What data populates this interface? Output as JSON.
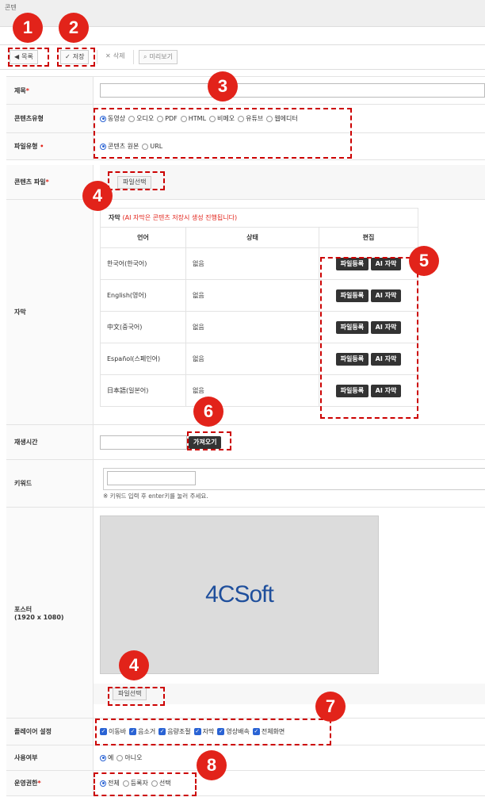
{
  "window": {
    "title": "콘텐"
  },
  "toolbar": {
    "list_label": "목록",
    "save_label": "저장",
    "delete_label": "삭제",
    "preview_label": "미리보기"
  },
  "form": {
    "title_label": "제목",
    "content_type_label": "콘텐츠유형",
    "content_types": [
      "동영상",
      "오디오",
      "PDF",
      "HTML",
      "비메오",
      "유튜브",
      "웹에디터"
    ],
    "file_type_label": "파일유형",
    "file_types": [
      "콘텐츠 원본",
      "URL"
    ],
    "content_file_label": "콘텐츠 파일",
    "file_select": "파일선택",
    "subtitle_label": "자막",
    "subtitle_title": "자막",
    "subtitle_note": "(AI 자막은 콘텐츠 저장시 생성 진행됩니다)",
    "subtitle_headers": [
      "언어",
      "상태",
      "편집"
    ],
    "subtitle_rows": [
      {
        "lang": "한국어(한국어)",
        "status": "없음"
      },
      {
        "lang": "English(영어)",
        "status": "없음"
      },
      {
        "lang": "中文(중국어)",
        "status": "없음"
      },
      {
        "lang": "Español(스페인어)",
        "status": "없음"
      },
      {
        "lang": "日本語(일본어)",
        "status": "없음"
      }
    ],
    "upload_btn": "파일등록",
    "ai_btn": "AI 자막",
    "playtime_label": "재생시간",
    "fetch_btn": "가져오기",
    "keyword_label": "키워드",
    "keyword_hint": "※ 키워드 입력 후 enter키를 눌러 주세요.",
    "poster_label": "포스터",
    "poster_size": "(1920 x 1080)",
    "poster_logo": "4CSoft",
    "player_label": "플레이어 설정",
    "player_options": [
      "이동바",
      "음소거",
      "음량조절",
      "자막",
      "영상배속",
      "전체화면"
    ],
    "use_label": "사용여부",
    "use_options": [
      "예",
      "아니오"
    ],
    "permission_label": "운영권한",
    "permission_options": [
      "전체",
      "등록자",
      "선택"
    ]
  },
  "badges": [
    "1",
    "2",
    "3",
    "4",
    "5",
    "6",
    "4",
    "7",
    "8"
  ],
  "colors": {
    "accent": "#2a63d4",
    "badge": "#e2231a",
    "dark_button": "#333333"
  }
}
